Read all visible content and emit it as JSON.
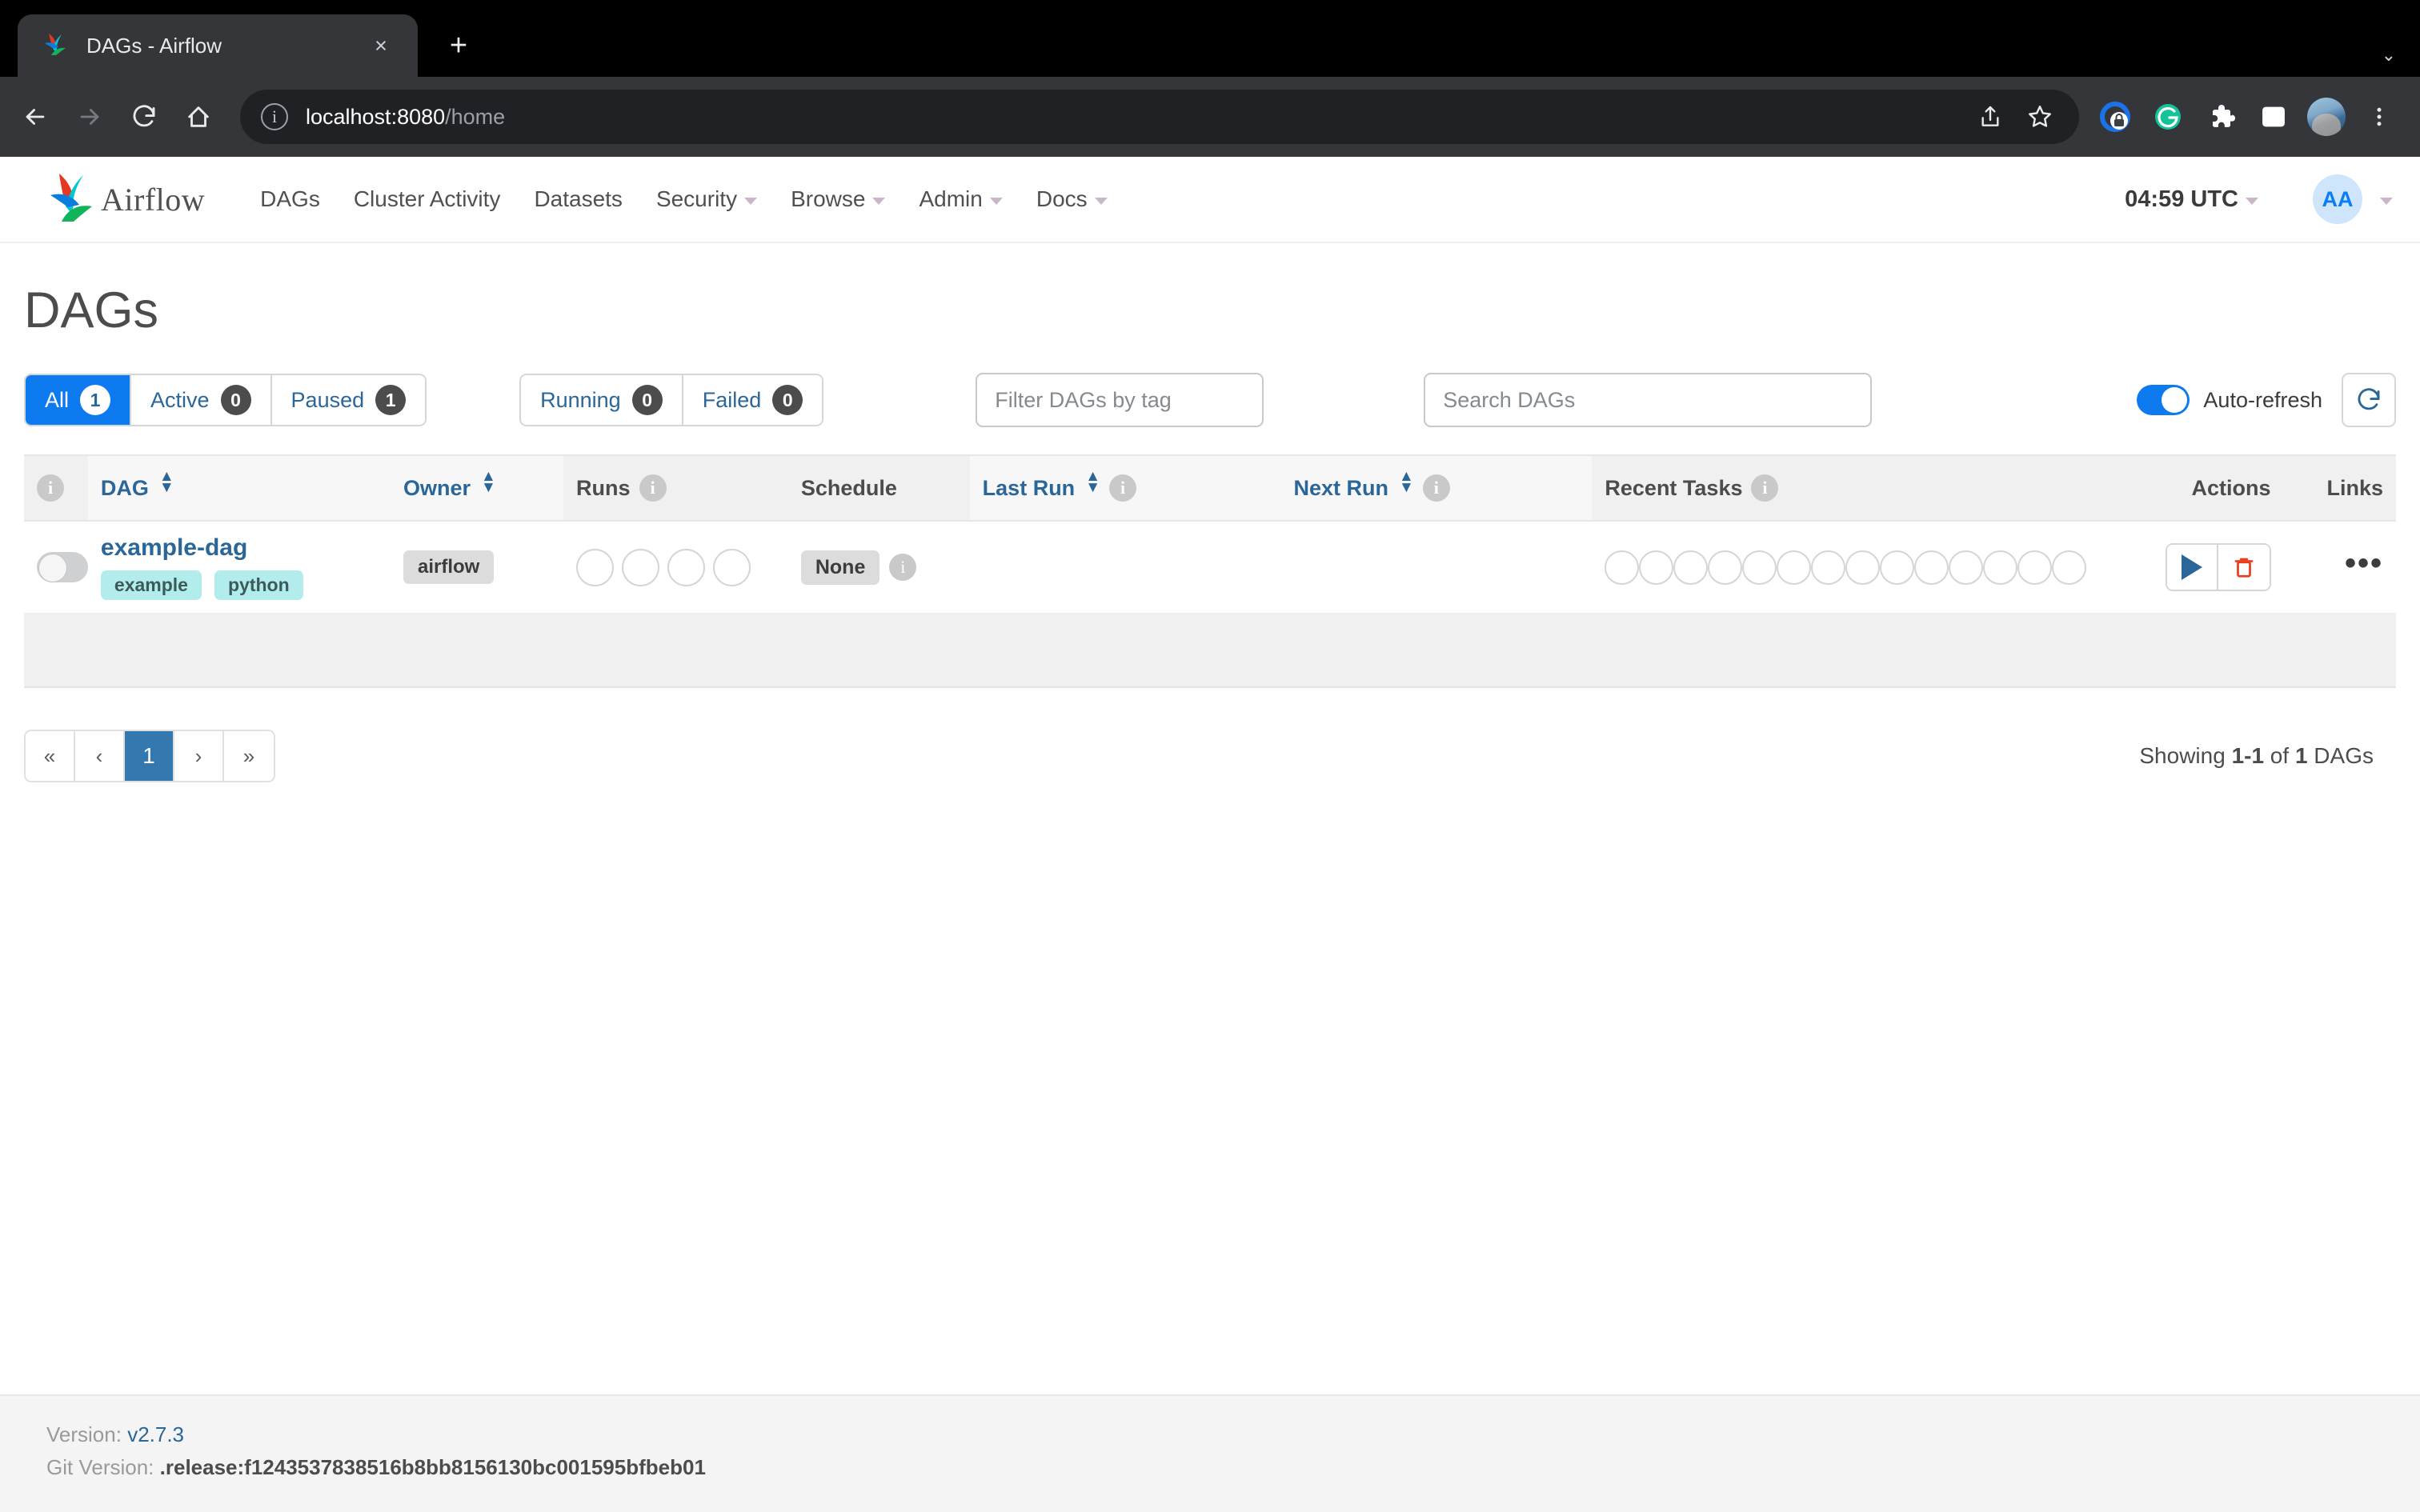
{
  "browser": {
    "tab": {
      "title": "DAGs - Airflow",
      "favicon": "airflow-pinwheel-icon",
      "close": "×"
    },
    "new_tab": "+",
    "tab_list_chevron": "⌄",
    "nav": {
      "back": "←",
      "forward": "→",
      "reload": "↻",
      "home": "⌂"
    },
    "omnibox": {
      "info_glyph": "i",
      "url_host": "localhost:8080",
      "url_path": "/home",
      "full_url": "localhost:8080/home"
    },
    "actions": {
      "share": "share-icon",
      "bookmark": "star-icon"
    },
    "extensions": [
      {
        "name": "password-manager-extension-icon",
        "color": "#1a73e8"
      },
      {
        "name": "grammarly-extension-icon",
        "color": "#15c39a"
      },
      {
        "name": "extensions-puzzle-icon",
        "color": "#ffffff"
      },
      {
        "name": "side-panel-icon",
        "color": "#ffffff"
      }
    ],
    "profile": "profile-avatar",
    "menu": "⋮"
  },
  "navbar": {
    "brand": "Airflow",
    "links": [
      {
        "label": "DAGs",
        "caret": false
      },
      {
        "label": "Cluster Activity",
        "caret": false
      },
      {
        "label": "Datasets",
        "caret": false
      },
      {
        "label": "Security",
        "caret": true
      },
      {
        "label": "Browse",
        "caret": true
      },
      {
        "label": "Admin",
        "caret": true
      },
      {
        "label": "Docs",
        "caret": true
      }
    ],
    "clock": "04:59 UTC",
    "user_initials": "AA"
  },
  "page": {
    "title": "DAGs"
  },
  "filters": {
    "status_group": [
      {
        "label": "All",
        "count": "1",
        "active": true
      },
      {
        "label": "Active",
        "count": "0",
        "active": false
      },
      {
        "label": "Paused",
        "count": "1",
        "active": false
      }
    ],
    "run_group": [
      {
        "label": "Running",
        "count": "0"
      },
      {
        "label": "Failed",
        "count": "0"
      }
    ],
    "tag_placeholder": "Filter DAGs by tag",
    "tag_value": "",
    "search_placeholder": "Search DAGs",
    "search_value": "",
    "auto_refresh_label": "Auto-refresh",
    "auto_refresh_on": true,
    "refresh_icon": "refresh-icon"
  },
  "table": {
    "columns": [
      {
        "key": "toggle",
        "label": "",
        "info": true,
        "sortable": false,
        "shade": true
      },
      {
        "key": "dag",
        "label": "DAG",
        "info": false,
        "sortable": true,
        "shade": false
      },
      {
        "key": "owner",
        "label": "Owner",
        "info": false,
        "sortable": true,
        "shade": false
      },
      {
        "key": "runs",
        "label": "Runs",
        "info": true,
        "sortable": false,
        "shade": true
      },
      {
        "key": "schedule",
        "label": "Schedule",
        "info": false,
        "sortable": false,
        "shade": true
      },
      {
        "key": "last_run",
        "label": "Last Run",
        "info": true,
        "sortable": true,
        "shade": false
      },
      {
        "key": "next_run",
        "label": "Next Run",
        "info": true,
        "sortable": true,
        "shade": false
      },
      {
        "key": "recent_tasks",
        "label": "Recent Tasks",
        "info": true,
        "sortable": false,
        "shade": true
      },
      {
        "key": "actions",
        "label": "Actions",
        "info": false,
        "sortable": false,
        "shade": true
      },
      {
        "key": "links",
        "label": "Links",
        "info": false,
        "sortable": false,
        "shade": true
      }
    ],
    "rows": [
      {
        "paused": true,
        "dag_id": "example-dag",
        "tags": [
          "example",
          "python"
        ],
        "owner": "airflow",
        "runs_circles": 4,
        "schedule": "None",
        "last_run": "",
        "next_run": "",
        "recent_tasks_circles": 14,
        "actions": {
          "trigger": "play-icon",
          "delete": "trash-icon"
        },
        "links": "more-dots-icon"
      }
    ]
  },
  "pagination": {
    "first": "«",
    "prev": "‹",
    "pages": [
      "1"
    ],
    "current_page": "1",
    "next": "›",
    "last": "»",
    "showing_prefix": "Showing ",
    "showing_range": "1-1",
    "showing_middle": " of ",
    "showing_total": "1",
    "showing_suffix": " DAGs"
  },
  "footer": {
    "version_label": "Version:",
    "version_value": "v2.7.3",
    "git_label": "Git Version:",
    "git_value": ".release:f1243537838516b8bb8156130bc001595bfbeb01"
  }
}
